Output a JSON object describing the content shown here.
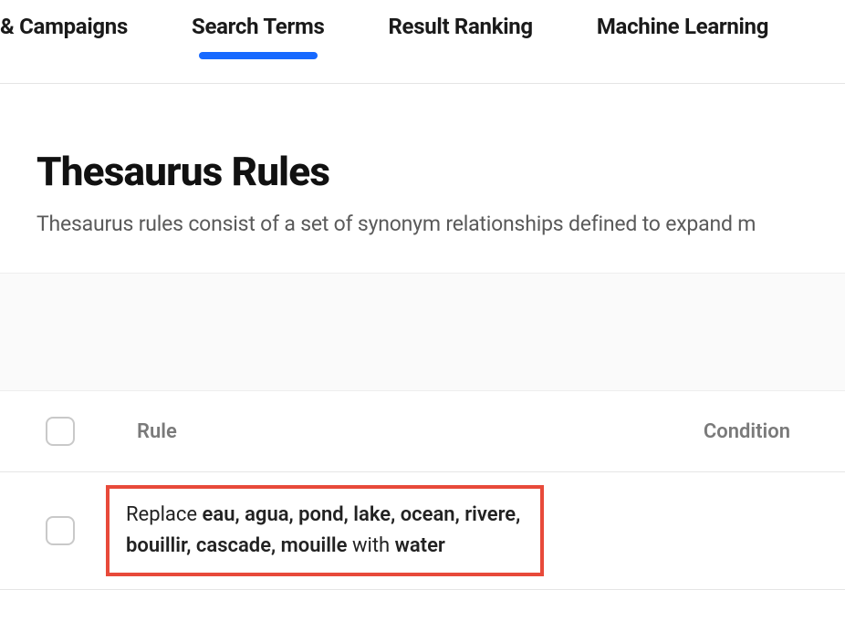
{
  "tabs": {
    "campaigns": "& Campaigns",
    "search_terms": "Search Terms",
    "result_ranking": "Result Ranking",
    "machine_learning": "Machine Learning"
  },
  "header": {
    "title": "Thesaurus Rules",
    "subtitle": "Thesaurus rules consist of a set of synonym relationships defined to expand m"
  },
  "table": {
    "col_rule": "Rule",
    "col_condition": "Condition"
  },
  "rule_row": {
    "word_replace": "Replace",
    "terms_line1": "eau, agua, pond, lake, ocean, rivere,",
    "terms_line2": "bouillir, cascade, mouille",
    "word_with": "with",
    "target": "water"
  }
}
